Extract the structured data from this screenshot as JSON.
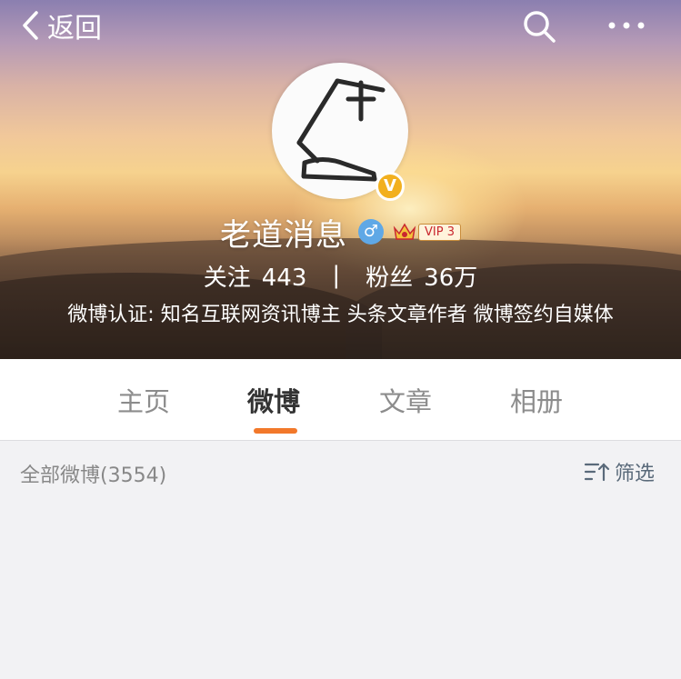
{
  "nav": {
    "back_label": "返回"
  },
  "profile": {
    "name": "老道消息",
    "verified_badge": "V",
    "gender_symbol": "♂",
    "vip_label": "VIP 3",
    "following_label": "关注",
    "following_count": "443",
    "separator": "|",
    "followers_label": "粉丝",
    "followers_count": "36万",
    "verification": "微博认证: 知名互联网资讯博主 头条文章作者 微博签约自媒体"
  },
  "tabs": [
    {
      "label": "主页",
      "active": false
    },
    {
      "label": "微博",
      "active": true
    },
    {
      "label": "文章",
      "active": false
    },
    {
      "label": "相册",
      "active": false
    }
  ],
  "feed": {
    "all_count_label": "全部微博(3554)",
    "filter_label": "筛选"
  },
  "colors": {
    "accent": "#f2782a",
    "verified": "#f2b01e",
    "gender_male": "#5fa8e6",
    "page_bg": "#f2f2f4"
  },
  "icons": [
    "back-icon",
    "search-icon",
    "more-icon",
    "lamp-avatar-icon",
    "crown-icon",
    "filter-icon"
  ]
}
